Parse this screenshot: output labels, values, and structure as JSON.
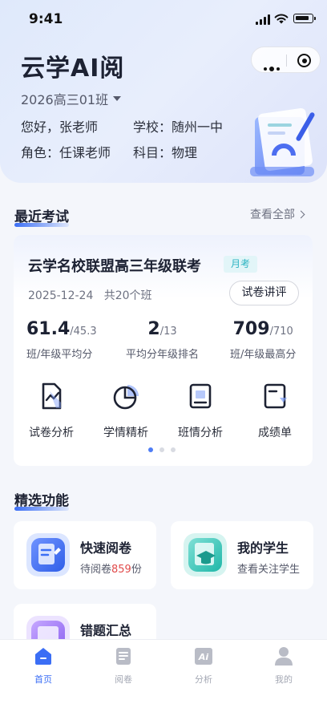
{
  "status_bar": {
    "time": "9:41"
  },
  "header": {
    "app_title": "云学AI阅",
    "class_name": "2026高三01班",
    "greeting": "您好，张老师",
    "school": "学校：随州一中",
    "role": "角色：任课老师",
    "subject": "科目：物理"
  },
  "recent_exam": {
    "section_title": "最近考试",
    "see_all": "查看全部",
    "exam": {
      "title": "云学名校联盟高三年级联考",
      "tag": "月考",
      "date_and_classes": "2025-12-24   共20个班",
      "review_button": "试卷讲评",
      "stats": [
        {
          "value": "61.4",
          "total": "/45.3",
          "label": "班/年级平均分"
        },
        {
          "value": "2",
          "total": "/13",
          "label": "平均分年级排名"
        },
        {
          "value": "709",
          "total": "/710",
          "label": "班/年级最高分"
        }
      ],
      "tools": [
        {
          "label": "试卷分析",
          "icon": "paper-chart-icon"
        },
        {
          "label": "学情精析",
          "icon": "pie-chart-icon"
        },
        {
          "label": "班情分析",
          "icon": "class-report-icon"
        },
        {
          "label": "成绩单",
          "icon": "score-sheet-icon"
        }
      ],
      "page_count": 3,
      "active_page": 1
    }
  },
  "features": {
    "section_title": "精选功能",
    "items": [
      {
        "name": "快速阅卷",
        "sub_prefix": "待阅卷",
        "sub_num": "859",
        "sub_suffix": "份",
        "icon": "quick-grading-icon"
      },
      {
        "name": "我的学生",
        "sub": "查看关注学生",
        "icon": "student-cap-icon"
      },
      {
        "name": "错题汇总",
        "icon": "wrong-questions-icon"
      }
    ]
  },
  "tabbar": {
    "tabs": [
      {
        "label": "首页",
        "icon": "home-icon",
        "active": true
      },
      {
        "label": "阅卷",
        "icon": "grading-icon",
        "active": false
      },
      {
        "label": "分析",
        "icon": "ai-analysis-icon",
        "active": false
      },
      {
        "label": "我的",
        "icon": "profile-icon",
        "active": false
      }
    ]
  },
  "colors": {
    "accent": "#3b6ef5",
    "tag_bg": "#e2f5f8",
    "tag_text": "#2db4c2",
    "highlight_number": "#e14b4b"
  }
}
